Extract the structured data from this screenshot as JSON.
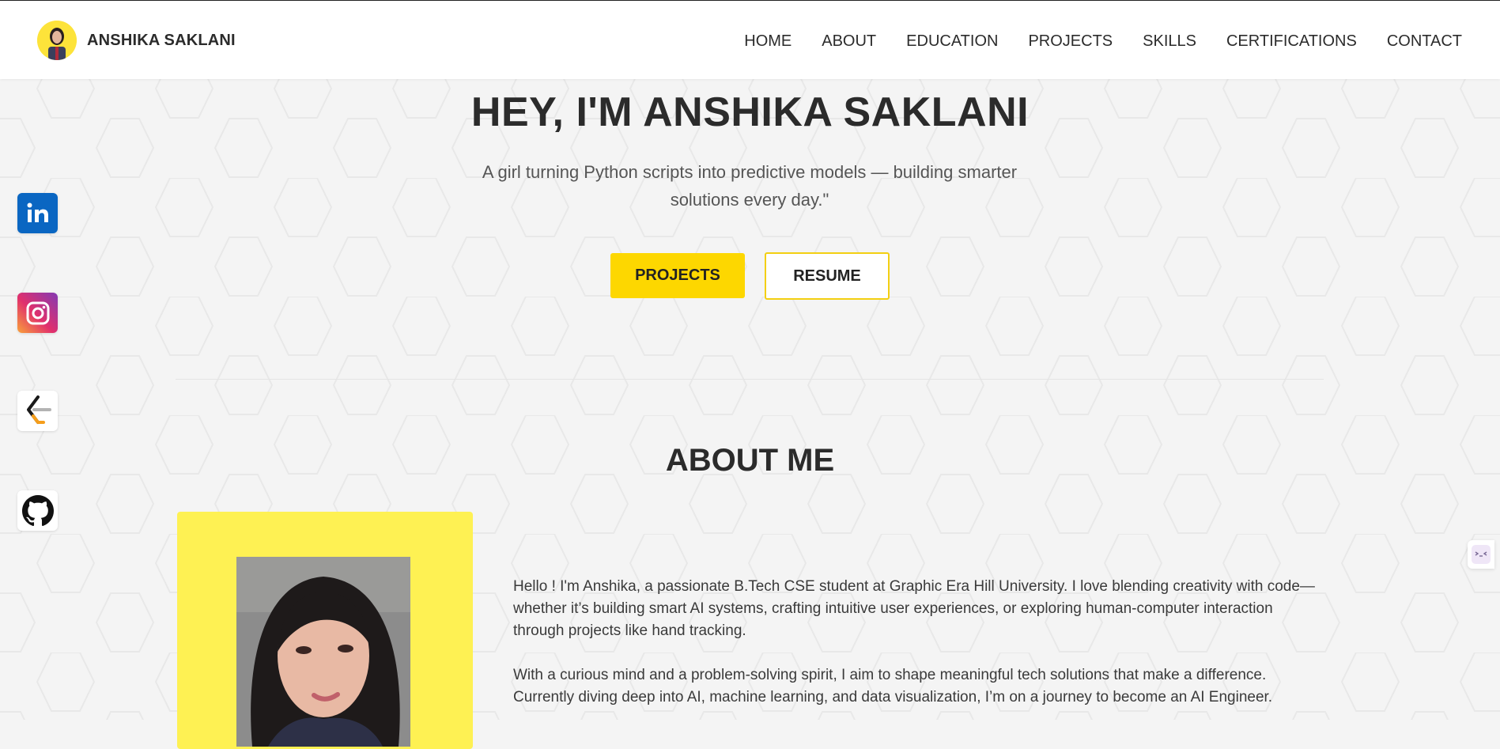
{
  "brand": {
    "name": "ANSHIKA SAKLANI",
    "avatar_icon": "profile-photo-icon"
  },
  "nav": {
    "items": [
      {
        "label": "HOME"
      },
      {
        "label": "ABOUT"
      },
      {
        "label": "EDUCATION"
      },
      {
        "label": "PROJECTS"
      },
      {
        "label": "SKILLS"
      },
      {
        "label": "CERTIFICATIONS"
      },
      {
        "label": "CONTACT"
      }
    ]
  },
  "hero": {
    "title": "HEY, I'M ANSHIKA SAKLANI",
    "subtitle": "A girl turning Python scripts into predictive models — building smarter solutions every day.\"",
    "projects_button": "PROJECTS",
    "resume_button": "RESUME"
  },
  "about": {
    "title": "ABOUT ME",
    "paragraphs": [
      "Hello ! I'm Anshika, a passionate B.Tech CSE student at Graphic Era Hill University. I love blending creativity with code—whether it’s building smart AI systems, crafting intuitive user experiences, or exploring human-computer interaction through projects like hand tracking.",
      "With a curious mind and a problem-solving spirit, I aim to shape meaningful tech solutions that make a difference. Currently diving deep into AI, machine learning, and data visualization, I’m on a journey to become an AI Engineer."
    ]
  },
  "socials": [
    {
      "icon": "linkedin-icon"
    },
    {
      "icon": "instagram-icon"
    },
    {
      "icon": "leetcode-icon"
    },
    {
      "icon": "github-icon"
    }
  ],
  "colors": {
    "accent": "#fdd700",
    "photo_frame": "#fef153",
    "background": "#f4f4f4",
    "text": "#2b2b2b"
  }
}
